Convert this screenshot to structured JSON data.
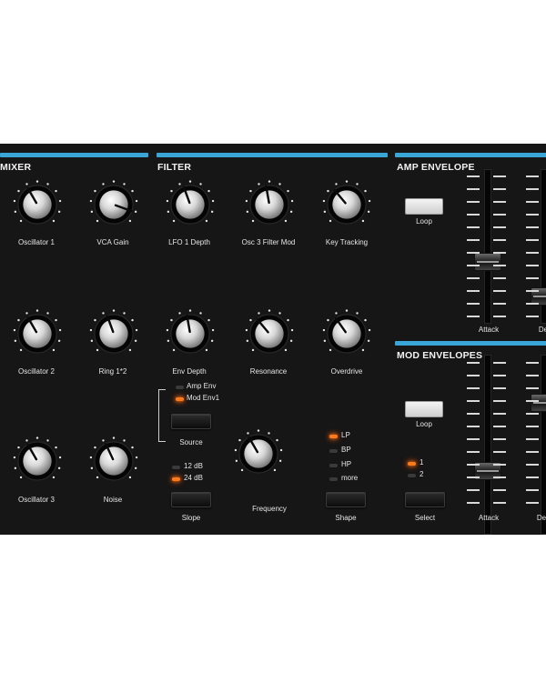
{
  "sections": {
    "mixer": "MIXER",
    "filter": "FILTER",
    "amp_envelope": "AMP ENVELOPE",
    "mod_envelopes": "MOD ENVELOPES"
  },
  "knobs": {
    "oscillator1": "Oscillator 1",
    "vca_gain": "VCA Gain",
    "lfo1_depth": "LFO 1 Depth",
    "osc3_filter_mod": "Osc 3 Filter Mod",
    "key_tracking": "Key Tracking",
    "oscillator2": "Oscillator 2",
    "ring": "Ring 1*2",
    "env_depth": "Env Depth",
    "resonance": "Resonance",
    "overdrive": "Overdrive",
    "oscillator3": "Oscillator 3",
    "noise": "Noise",
    "frequency": "Frequency"
  },
  "source": {
    "options": [
      "Amp Env",
      "Mod Env1"
    ],
    "active_index": 1,
    "button_label": "Source"
  },
  "slope": {
    "options": [
      "12 dB",
      "24 dB"
    ],
    "active_index": 1,
    "button_label": "Slope"
  },
  "shape": {
    "options": [
      "LP",
      "BP",
      "HP",
      "more"
    ],
    "active_index": 0,
    "button_label": "Shape"
  },
  "select": {
    "options": [
      "1",
      "2"
    ],
    "active_index": 0,
    "button_label": "Select"
  },
  "amp_env": {
    "loop_label": "Loop",
    "attack_label": "Attack",
    "decay_label": "De"
  },
  "mod_env": {
    "loop_label": "Loop",
    "attack_label": "Attack",
    "decay_label": "Dec"
  },
  "colors": {
    "accent": "#3aa6d8",
    "led_on": "#ff7a1a",
    "panel": "#161616"
  }
}
